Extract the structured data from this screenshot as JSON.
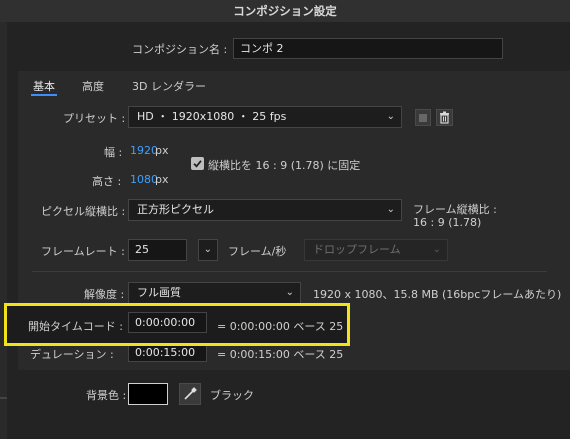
{
  "window": {
    "title": "コンポジション設定"
  },
  "composition_name": {
    "label": "コンポジション名 :",
    "value": "コンポ 2"
  },
  "tabs": [
    {
      "label": "基本"
    },
    {
      "label": "高度"
    },
    {
      "label": "3D レンダラー"
    }
  ],
  "preset": {
    "label": "プリセット :",
    "value": "HD ・ 1920x1080 ・ 25 fps"
  },
  "width": {
    "label": "幅 :",
    "value": "1920",
    "unit": "px"
  },
  "height": {
    "label": "高さ :",
    "value": "1080",
    "unit": "px"
  },
  "lock_aspect": {
    "label": "縦横比を 16 : 9 (1.78) に固定",
    "checked": true
  },
  "pixel_aspect": {
    "label": "ピクセル縦横比 :",
    "value": "正方形ピクセル"
  },
  "frame_aspect": {
    "label": "フレーム縦横比 :",
    "value": "16 : 9 (1.78)"
  },
  "frame_rate": {
    "label": "フレームレート :",
    "value": "25",
    "unit": "フレーム/秒",
    "drop_frame": "ドロップフレーム"
  },
  "resolution": {
    "label": "解像度 :",
    "value": "フル画質",
    "info": "1920 x 1080、15.8 MB (16bpcフレームあたり)"
  },
  "start_timecode": {
    "label": "開始タイムコード :",
    "value": "0:00:00:00",
    "info": "= 0:00:00:00  ベース 25"
  },
  "duration": {
    "label": "デュレーション :",
    "value": "0:00:15:00",
    "info": "= 0:00:15:00  ベース 25"
  },
  "background": {
    "label": "背景色 :",
    "color_name": "ブラック",
    "color": "#000000"
  },
  "highlight_color": "#f2e21b",
  "accent_color": "#3f8cff"
}
